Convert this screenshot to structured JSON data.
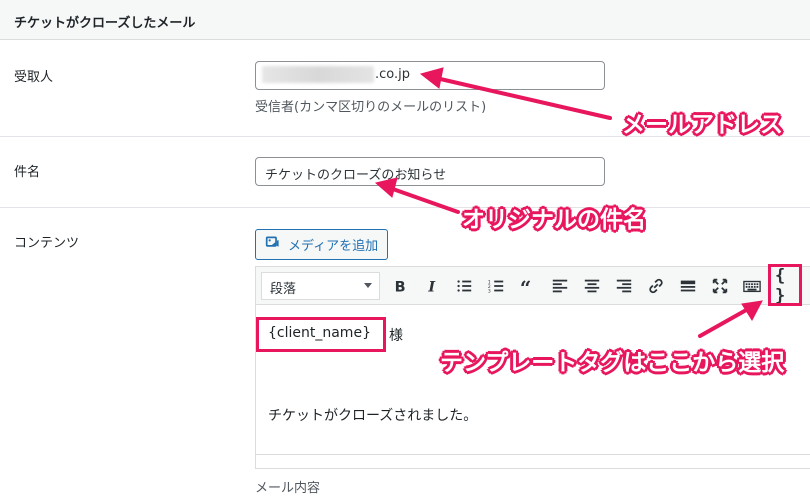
{
  "section": {
    "title": "チケットがクローズしたメール"
  },
  "recipient": {
    "label": "受取人",
    "value_suffix": ".co.jp",
    "description": "受信者(カンマ区切りのメールのリスト)"
  },
  "subject": {
    "label": "件名",
    "value": "チケットのクローズのお知らせ"
  },
  "content": {
    "label": "コンテンツ",
    "add_media_label": "メディアを追加",
    "format_select": "段落",
    "toolbar_icons": [
      "bold-icon",
      "italic-icon",
      "bullet-list-icon",
      "numbered-list-icon",
      "blockquote-icon",
      "align-left-icon",
      "align-center-icon",
      "align-right-icon",
      "link-icon",
      "read-more-icon",
      "fullscreen-icon",
      "keyboard-icon",
      "template-tag-icon"
    ],
    "template_tag_button": "{ }",
    "body": {
      "client_tag": "{client_name}",
      "honorific": "様",
      "message": "チケットがクローズされました。"
    },
    "description": "メール内容"
  },
  "annotations": {
    "email_address": "メールアドレス",
    "original_subject": "オリジナルの件名",
    "template_tag_hint": "テンプレートタグはここから選択",
    "color": "#e8175d"
  }
}
